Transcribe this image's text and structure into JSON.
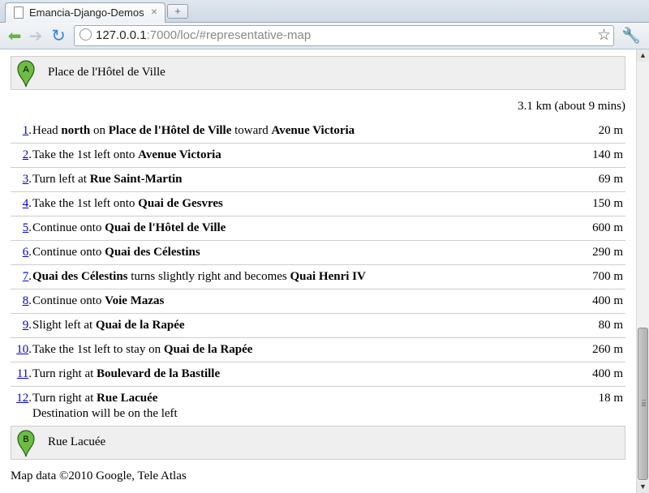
{
  "browser": {
    "tab_title": "Emancia-Django-Demos",
    "tab_close": "×",
    "new_tab": "+",
    "url_host": "127.0.0.1",
    "url_rest": ":7000/loc/#representative-map"
  },
  "route": {
    "start": {
      "marker": "A",
      "name": "Place de l'Hôtel de Ville"
    },
    "end": {
      "marker": "B",
      "name": "Rue Lacuée"
    },
    "summary": "3.1 km (about 9 mins)",
    "steps": [
      {
        "num": "1.",
        "distance": "20 m",
        "parts": [
          [
            "t",
            "Head "
          ],
          [
            "b",
            "north"
          ],
          [
            "t",
            " on "
          ],
          [
            "b",
            "Place de l'Hôtel de Ville"
          ],
          [
            "t",
            " toward "
          ],
          [
            "b",
            "Avenue Victoria"
          ]
        ]
      },
      {
        "num": "2.",
        "distance": "140 m",
        "parts": [
          [
            "t",
            "Take the 1st left onto "
          ],
          [
            "b",
            "Avenue Victoria"
          ]
        ]
      },
      {
        "num": "3.",
        "distance": "69 m",
        "parts": [
          [
            "t",
            "Turn left at "
          ],
          [
            "b",
            "Rue Saint-Martin"
          ]
        ]
      },
      {
        "num": "4.",
        "distance": "150 m",
        "parts": [
          [
            "t",
            "Take the 1st left onto "
          ],
          [
            "b",
            "Quai de Gesvres"
          ]
        ]
      },
      {
        "num": "5.",
        "distance": "600 m",
        "parts": [
          [
            "t",
            "Continue onto "
          ],
          [
            "b",
            "Quai de l'Hôtel de Ville"
          ]
        ]
      },
      {
        "num": "6.",
        "distance": "290 m",
        "parts": [
          [
            "t",
            "Continue onto "
          ],
          [
            "b",
            "Quai des Célestins"
          ]
        ]
      },
      {
        "num": "7.",
        "distance": "700 m",
        "parts": [
          [
            "b",
            "Quai des Célestins"
          ],
          [
            "t",
            " turns slightly right and becomes "
          ],
          [
            "b",
            "Quai Henri IV"
          ]
        ]
      },
      {
        "num": "8.",
        "distance": "400 m",
        "parts": [
          [
            "t",
            "Continue onto "
          ],
          [
            "b",
            "Voie Mazas"
          ]
        ]
      },
      {
        "num": "9.",
        "distance": "80 m",
        "parts": [
          [
            "t",
            "Slight left at "
          ],
          [
            "b",
            "Quai de la Rapée"
          ]
        ]
      },
      {
        "num": "10.",
        "distance": "260 m",
        "parts": [
          [
            "t",
            "Take the 1st left to stay on "
          ],
          [
            "b",
            "Quai de la Rapée"
          ]
        ]
      },
      {
        "num": "11.",
        "distance": "400 m",
        "parts": [
          [
            "t",
            "Turn right at "
          ],
          [
            "b",
            "Boulevard de la Bastille"
          ]
        ]
      },
      {
        "num": "12.",
        "distance": "18 m",
        "parts": [
          [
            "t",
            "Turn right at "
          ],
          [
            "b",
            "Rue Lacuée"
          ],
          [
            "br",
            ""
          ],
          [
            "t",
            "Destination will be on the left"
          ]
        ]
      }
    ],
    "copyright": "Map data ©2010 Google, Tele Atlas"
  },
  "colors": {
    "pin_fill": "#6dbd45",
    "link": "#0000cc",
    "waypoint_bg": "#efefef"
  },
  "icons": [
    "page-icon",
    "back-arrow-icon",
    "forward-arrow-icon",
    "reload-icon",
    "globe-icon",
    "star-icon",
    "wrench-icon",
    "map-pin-icon"
  ]
}
